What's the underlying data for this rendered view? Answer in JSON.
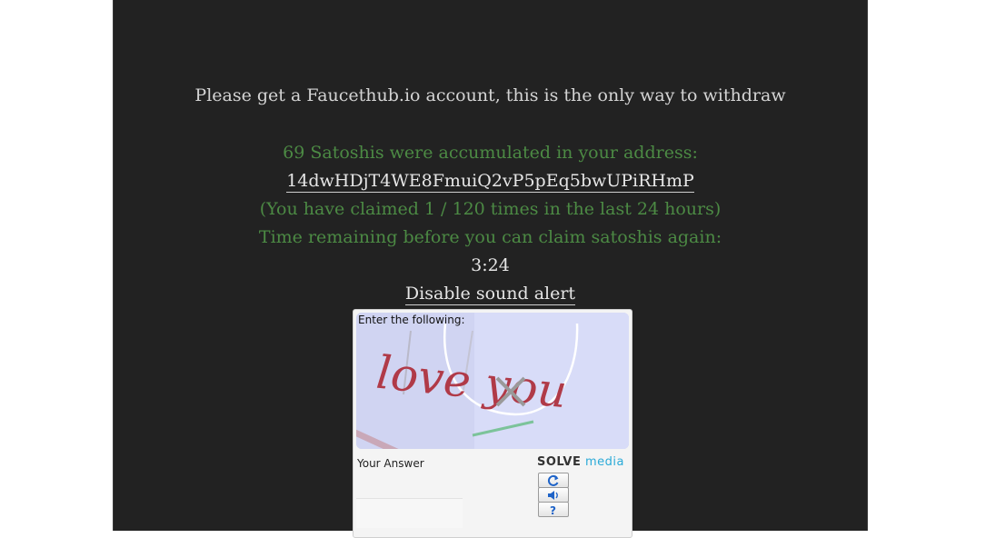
{
  "notice": "Please get a Faucethub.io account, this is the only way to withdraw",
  "status": {
    "accumulated": "69 Satoshis were accumulated in your address:",
    "address": "14dwHDjT4WE8FmuiQ2vP5pEq5bwUPiRHmP",
    "claims": "(You have claimed 1 / 120 times in the last 24 hours)",
    "time_label": "Time remaining before you can claim satoshis again:",
    "timer": "3:24",
    "sound_link": "Disable sound alert"
  },
  "captcha": {
    "instruction": "Enter the following:",
    "challenge_text": "love you",
    "answer_label": "Your Answer",
    "answer_value": "",
    "brand_solve": "SOLVE",
    "brand_media": "media",
    "buttons": [
      "refresh-icon",
      "audio-icon",
      "help-icon"
    ]
  }
}
